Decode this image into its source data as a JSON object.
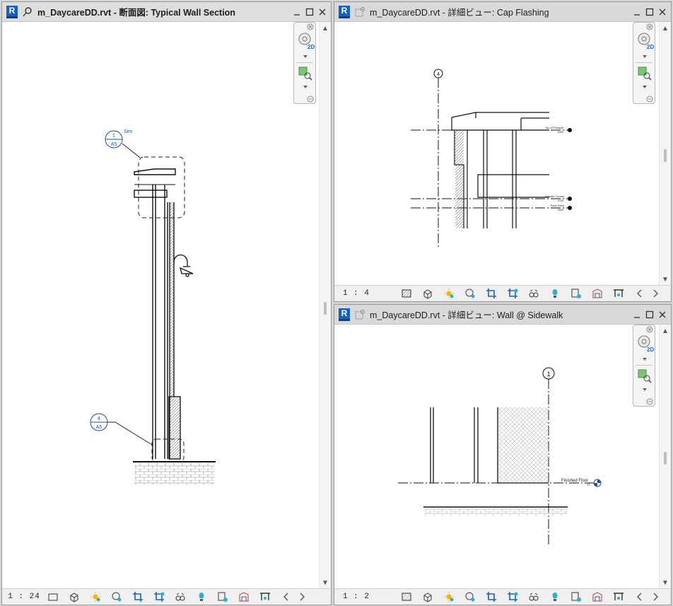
{
  "windows": {
    "left": {
      "title": "m_DaycareDD.rvt - 断面図: Typical Wall Section",
      "scale": "1 : 24",
      "callouts": [
        {
          "top": "1",
          "bottom": "A5",
          "tag": "Sim"
        },
        {
          "top": "4",
          "bottom": "A5"
        }
      ]
    },
    "top_right": {
      "title": "m_DaycareDD.rvt - 詳細ビュー: Cap Flashing",
      "scale": "1 : 4",
      "grid_label": "4",
      "levels": [
        "Top of Parapet",
        "Header Course",
        "Roof Deck"
      ],
      "level_values": [
        "6300",
        "5700",
        "5550"
      ]
    },
    "bottom_right": {
      "title": "m_DaycareDD.rvt - 詳細ビュー: Wall @ Sidewalk",
      "scale": "1 : 2",
      "grid_label": "1",
      "levels": [
        "Finished Floor"
      ],
      "level_values": [
        "0"
      ]
    }
  },
  "navbar": {
    "wheel_label": "2D"
  },
  "statusbar_icons": [
    "detail-level-icon",
    "visual-style-icon",
    "sun-path-icon",
    "shadows-icon",
    "crop-view-icon",
    "show-crop-icon",
    "temporary-hide-icon",
    "reveal-hidden-icon",
    "temporary-view-properties-icon",
    "analytical-model-icon",
    "highlight-displacement-icon",
    "constraints-icon"
  ],
  "colors": {
    "accent": "#1560c4",
    "callout": "#1f4fb0",
    "titlebar": "#d9d9d9"
  }
}
